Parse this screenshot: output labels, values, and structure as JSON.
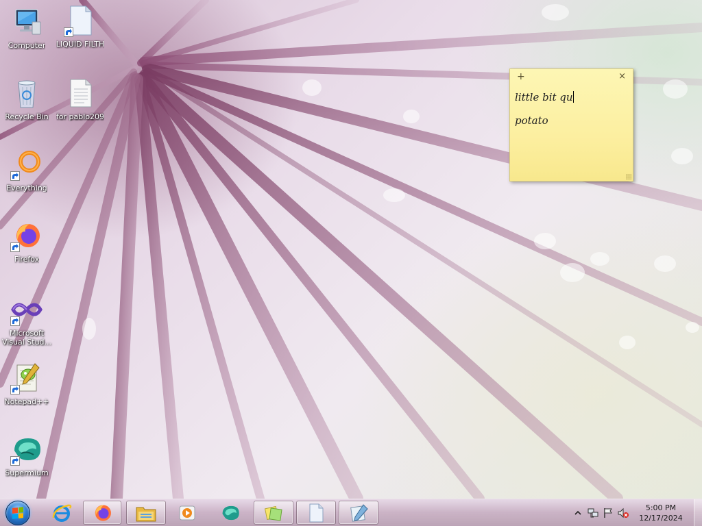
{
  "desktop": {
    "icons": [
      {
        "label": "Computer",
        "icon": "computer-icon"
      },
      {
        "label": "LIQUID FILTH",
        "icon": "document-icon"
      },
      {
        "label": "Recycle Bin",
        "icon": "recycle-bin-icon"
      },
      {
        "label": "for pablo209",
        "icon": "text-file-icon"
      },
      {
        "label": "Everything",
        "icon": "everything-icon"
      },
      {
        "label": "Firefox",
        "icon": "firefox-icon"
      },
      {
        "label": "Microsoft Visual Stud...",
        "icon": "visual-studio-icon"
      },
      {
        "label": "Notepad++",
        "icon": "notepadpp-icon"
      },
      {
        "label": "Supermium",
        "icon": "supermium-icon"
      }
    ]
  },
  "sticky_note": {
    "add_glyph": "+",
    "close_glyph": "×",
    "lines": [
      "little bit qu",
      "",
      "potato"
    ],
    "color": "#fcefa0"
  },
  "taskbar": {
    "start_icon": "windows-orb-icon",
    "apps": [
      {
        "name": "internet-explorer",
        "icon": "internet-explorer-icon",
        "active": false
      },
      {
        "name": "firefox",
        "icon": "firefox-icon",
        "active": true
      },
      {
        "name": "file-explorer",
        "icon": "folder-icon",
        "active": true
      },
      {
        "name": "media-player",
        "icon": "media-player-icon",
        "active": false
      },
      {
        "name": "supermium",
        "icon": "supermium-icon",
        "active": false
      },
      {
        "name": "sticky-notes",
        "icon": "sticky-notes-icon",
        "active": true
      },
      {
        "name": "notepad",
        "icon": "notepad-icon",
        "active": true
      },
      {
        "name": "notepadpp",
        "icon": "notepadpp-taskbar-icon",
        "active": true
      }
    ]
  },
  "tray": {
    "time": "5:00 PM",
    "date": "12/17/2024",
    "icons": [
      "show-hidden-icons-icon",
      "network-icon",
      "action-center-flag-icon",
      "volume-muted-icon"
    ]
  }
}
